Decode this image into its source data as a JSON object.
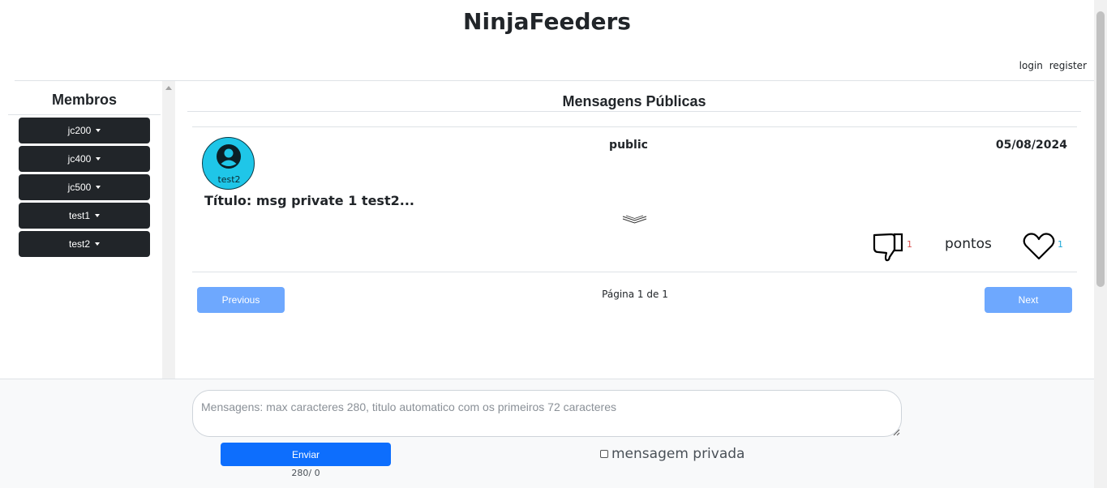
{
  "app": {
    "title": "NinjaFeeders"
  },
  "auth": {
    "login": "login",
    "register": "register"
  },
  "sidebar": {
    "title": "Membros",
    "members": [
      "jc200",
      "jc400",
      "jc500",
      "test1",
      "test2"
    ]
  },
  "feed": {
    "title": "Mensagens Públicas",
    "post": {
      "author": "test2",
      "visibility": "public",
      "date": "05/08/2024",
      "title": "Título: msg private 1 test2...",
      "dislikes": "1",
      "points_label": "pontos",
      "likes": "1"
    },
    "pagination": {
      "previous": "Previous",
      "next": "Next",
      "info": "Página 1 de 1"
    }
  },
  "composer": {
    "placeholder": "Mensagens: max caracteres 280, titulo automatico com os primeiros 72 caracteres",
    "send_label": "Enviar",
    "counter": "280/ 0",
    "private_label": "mensagem privada"
  },
  "icons": {
    "avatar": "person-circle-icon",
    "expand": "double-chevron-down-icon",
    "dislike": "thumbs-down-icon",
    "like": "heart-icon"
  },
  "colors": {
    "dark_button": "#212529",
    "primary": "#0d6efd",
    "primary_light": "#6ea8fe",
    "avatar_bg": "#1fc6e8",
    "dislike_count": "#d9534f",
    "like_count": "#1fa8d8"
  }
}
